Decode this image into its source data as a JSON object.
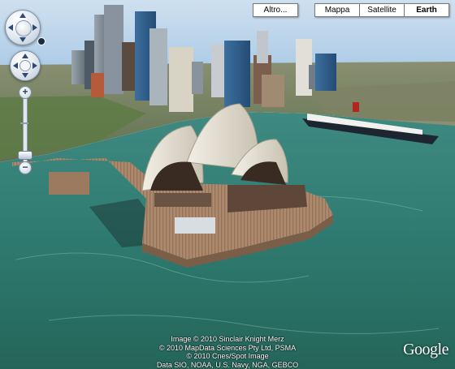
{
  "map_type": {
    "buttons": [
      {
        "label": "Altro...",
        "active": false
      },
      {
        "label": "Mappa",
        "active": false
      },
      {
        "label": "Satellite",
        "active": false
      },
      {
        "label": "Earth",
        "active": true
      }
    ]
  },
  "controls": {
    "zoom_in": "+",
    "zoom_out": "−"
  },
  "attribution": {
    "lines": [
      "Image © 2010 Sinclair Knight Merz",
      "© 2010 MapData Sciences Pty Ltd, PSMA",
      "© 2010 Cnes/Spot Image",
      "Data SIO, NOAA, U.S. Navy, NGA, GEBCO"
    ]
  },
  "logo": {
    "text": "Google"
  },
  "colors": {
    "sky": "#a9c9e6",
    "water": "#2f7a70",
    "opera_roof": "#e7e2d6",
    "podium": "#a98467"
  }
}
